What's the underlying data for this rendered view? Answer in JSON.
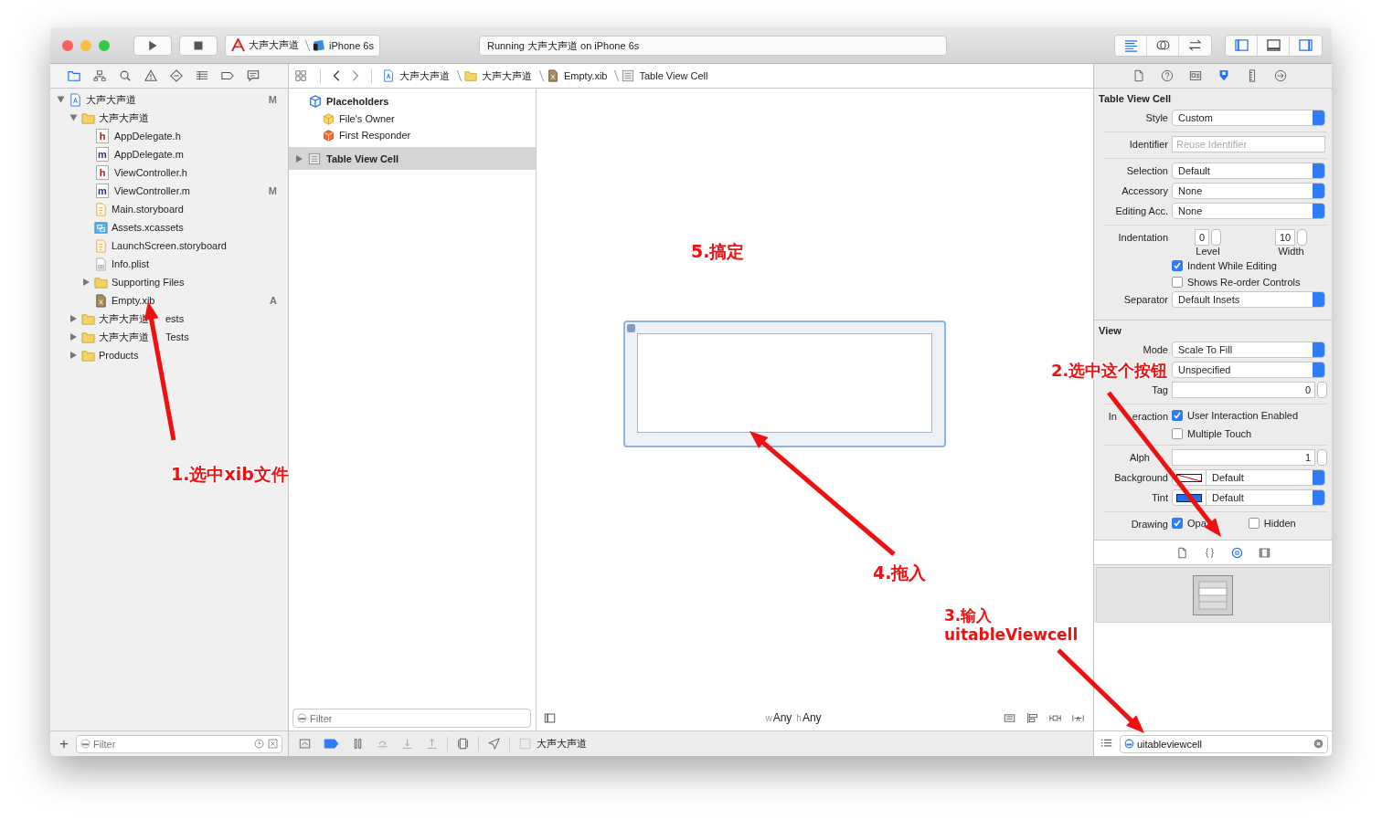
{
  "toolbar": {
    "scheme": "大声大声道",
    "device": "iPhone 6s",
    "activity": "Running 大声大声道 on iPhone 6s",
    "editor_modes": [
      {
        "selected": true
      },
      {
        "selected": false
      },
      {
        "selected": false
      }
    ],
    "panels": [
      {
        "on": true
      },
      {
        "on": false
      },
      {
        "on": true
      }
    ]
  },
  "navigator": {
    "tabs": [
      {
        "selected": true
      },
      {
        "selected": false
      },
      {
        "selected": false
      },
      {
        "selected": false
      },
      {
        "selected": false
      },
      {
        "selected": false
      },
      {
        "selected": false
      },
      {
        "selected": false
      }
    ],
    "tree": [
      {
        "name": "大声大声道",
        "kind": "project",
        "badge": "M",
        "expanded": true,
        "children": [
          {
            "name": "大声大声道",
            "kind": "folder",
            "expanded": true,
            "children": [
              {
                "name": "AppDelegate.h",
                "kind": "source",
                "glyph": "h"
              },
              {
                "name": "AppDelegate.m",
                "kind": "source",
                "glyph": "m"
              },
              {
                "name": "ViewController.h",
                "kind": "source",
                "glyph": "h"
              },
              {
                "name": "ViewController.m",
                "kind": "source",
                "glyph": "m",
                "badge": "M"
              },
              {
                "name": "Main.storyboard",
                "kind": "storyboard"
              },
              {
                "name": "Assets.xcassets",
                "kind": "assets"
              },
              {
                "name": "LaunchScreen.storyboard",
                "kind": "storyboard"
              },
              {
                "name": "Info.plist",
                "kind": "plist"
              },
              {
                "name": "Supporting Files",
                "kind": "folder",
                "expanded": false
              },
              {
                "name": "Empty.xib",
                "kind": "xib",
                "badge": "A"
              }
            ]
          },
          {
            "name": [
              "大声大声道",
              "ests"
            ],
            "kind": "folder",
            "expanded": false
          },
          {
            "name": [
              "大声大声道",
              "Tests"
            ],
            "kind": "folder",
            "expanded": false
          },
          {
            "name": "Products",
            "kind": "folder",
            "expanded": false
          }
        ]
      }
    ],
    "add_button": "+",
    "filter_placeholder": "Filter"
  },
  "jump_bar": [
    {
      "kind": "project",
      "text": "大声大声道"
    },
    {
      "kind": "folder",
      "text": "大声大声道"
    },
    {
      "kind": "xib",
      "text": "Empty.xib"
    },
    {
      "kind": "cell",
      "text": "Table View Cell"
    }
  ],
  "outline": {
    "section": "Placeholders",
    "placeholders": [
      {
        "kind": "owner",
        "text": "File's Owner"
      },
      {
        "kind": "responder",
        "text": "First Responder"
      }
    ],
    "items": [
      {
        "text": "Table View Cell",
        "selected": true,
        "expanded": false
      }
    ],
    "filter_placeholder": "Filter"
  },
  "canvas": {
    "size_class": [
      {
        "prefix": "w",
        "value": "Any"
      },
      {
        "prefix": "h",
        "value": "Any"
      }
    ]
  },
  "debug_bar": {
    "breakpoints_active": true,
    "target": "大声大声道"
  },
  "inspector": {
    "tabs": [
      {
        "selected": false
      },
      {
        "selected": false
      },
      {
        "selected": false
      },
      {
        "selected": true
      },
      {
        "selected": false
      },
      {
        "selected": false
      }
    ],
    "sections": [
      {
        "title": "Table View Cell",
        "groups": [
          [
            {
              "kind": "select",
              "label": "Style",
              "value": "Custom"
            }
          ],
          [
            {
              "kind": "field",
              "label": "Identifier",
              "placeholder": "Reuse Identifier"
            }
          ],
          [
            {
              "kind": "select",
              "label": "Selection",
              "value": "Default"
            },
            {
              "kind": "select",
              "label": "Accessory",
              "value": "None"
            },
            {
              "kind": "select",
              "label": "Editing Acc.",
              "value": "None"
            }
          ],
          [
            {
              "kind": "steppers",
              "label": "Indentation",
              "fields": [
                {
                  "value": "0",
                  "caption": "Level"
                },
                {
                  "value": "10",
                  "caption": "Width"
                }
              ]
            },
            {
              "kind": "checkbox",
              "text": "Indent While Editing",
              "checked": true
            },
            {
              "kind": "checkbox",
              "text": "Shows Re-order Controls",
              "checked": false
            },
            {
              "kind": "select",
              "label": "Separator",
              "value": "Default Insets"
            }
          ]
        ]
      },
      {
        "title": "View",
        "groups": [
          [
            {
              "kind": "select",
              "label": "Mode",
              "value": "Scale To Fill"
            },
            {
              "kind": "select",
              "value": "Unspecified"
            },
            {
              "kind": "number",
              "label": "Tag",
              "value": "0"
            }
          ],
          [
            {
              "kind": "checkbox",
              "label": [
                "In",
                "eraction"
              ],
              "text": "User Interaction Enabled",
              "checked": true
            },
            {
              "kind": "checkbox",
              "text": "Multiple Touch",
              "checked": false
            }
          ],
          [
            {
              "kind": "number",
              "label": [
                "Alph"
              ],
              "value": "1"
            },
            {
              "kind": "color",
              "label": "Background",
              "clear": true,
              "value": "Default"
            },
            {
              "kind": "color",
              "label": "Tint",
              "clear": false,
              "color": "#1f6ff1",
              "value": "Default"
            }
          ],
          [
            {
              "kind": "checkpair",
              "label": "Drawing",
              "items": [
                {
                  "text": "Opa",
                  "checked": true
                },
                {
                  "text": "Hidden",
                  "checked": false
                }
              ]
            }
          ]
        ]
      }
    ]
  },
  "library": {
    "tabs": [
      {
        "selected": false
      },
      {
        "selected": false
      },
      {
        "selected": true
      },
      {
        "selected": false
      }
    ],
    "search_value": "uitableviewcell"
  },
  "annotations": [
    {
      "text": "1.选中xib文件"
    },
    {
      "text": "2.选中这个按钮"
    },
    {
      "text": "3.输入"
    },
    {
      "text": "uitableViewcell"
    },
    {
      "text": "4.拖入"
    },
    {
      "text": "5.搞定"
    }
  ]
}
